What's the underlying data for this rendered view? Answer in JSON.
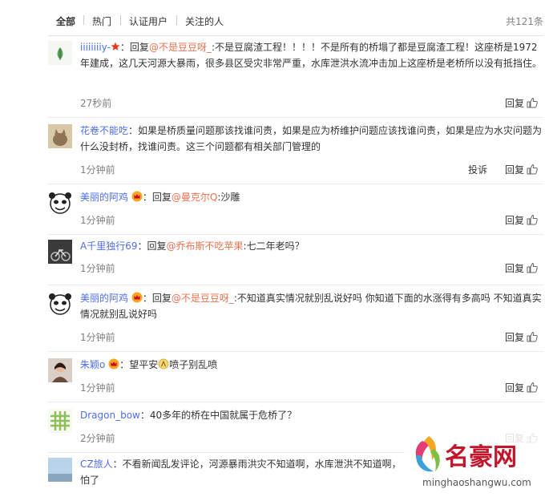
{
  "tabs": [
    "全部",
    "热门",
    "认证用户",
    "关注的人"
  ],
  "total": "共121条",
  "colors": {
    "name": "#eb7350",
    "time": "#808080",
    "border": "#ececec"
  },
  "comments": [
    {
      "user": "iiiiiiiiy-",
      "sep": "：",
      "prefix": "回复",
      "mention": "@不是豆豆呀_",
      "text": ":不是豆腐渣工程！！！！不是所有的桥塌了都是豆腐渣工程！这座桥是1972年建成，这几天河源大暴雨，很多县区受灾非常严重，水库泄洪水流冲击加上这座桥是老桥所以没有抵挡住。",
      "time": "27秒前",
      "reply": "回复",
      "avatar_icon": "leaf-avatar"
    },
    {
      "user": "花卷不能吃",
      "sep": "：",
      "text": "如果是桥质量问题那该找谁问责，如果是应为桥维护问题应该找谁问责，如果是应为水灾问题为什么没封桥，找谁问责。这三个问题都有相关部门管理的",
      "time": "1分钟前",
      "report": "投诉",
      "reply": "回复",
      "avatar_icon": "cat-avatar"
    },
    {
      "user": "美丽的阿鸡",
      "sep": "：",
      "prefix": "回复",
      "mention": "@曼克尔Q",
      "text": ":沙雕",
      "time": "1分钟前",
      "reply": "回复",
      "avatar_icon": "panda-meme-avatar"
    },
    {
      "user": "A千里独行69",
      "sep": "：",
      "prefix": "回复",
      "mention": "@乔布斯不吃苹果",
      "text": ":七二年老吗？",
      "time": "1分钟前",
      "reply": "回复",
      "avatar_icon": "motorbike-avatar"
    },
    {
      "user": "美丽的阿鸡",
      "sep": "：",
      "prefix": "回复",
      "mention": "@不是豆豆呀_",
      "text": ":不知道真实情况就别乱说好吗 你知道下面的水涨得有多高吗 不知道真实情况就别乱说好吗",
      "time": "1分钟前",
      "reply": "回复",
      "avatar_icon": "panda-meme-avatar"
    },
    {
      "user": "朱颖o",
      "sep": "：",
      "text_a": "望平安",
      "text_b": "喷子别乱喷",
      "time": "1分钟前",
      "reply": "回复",
      "avatar_icon": "woman-avatar"
    },
    {
      "user": "Dragon_bow",
      "sep": "：",
      "text": "40多年的桥在中国就属于危桥了？",
      "time": "2分钟前",
      "reply": "回复",
      "avatar_icon": "grid-avatar"
    },
    {
      "user": "CZ旅人",
      "sep": "：",
      "text": "不看新闻乱发评论，河源暴雨洪灾不知道啊，水库泄洪不知道啊，",
      "text_tail": "怕了",
      "avatar_icon": "sky-avatar"
    }
  ],
  "watermark": {
    "brand": "名豪网",
    "url": "minghaoshangwu.com"
  }
}
